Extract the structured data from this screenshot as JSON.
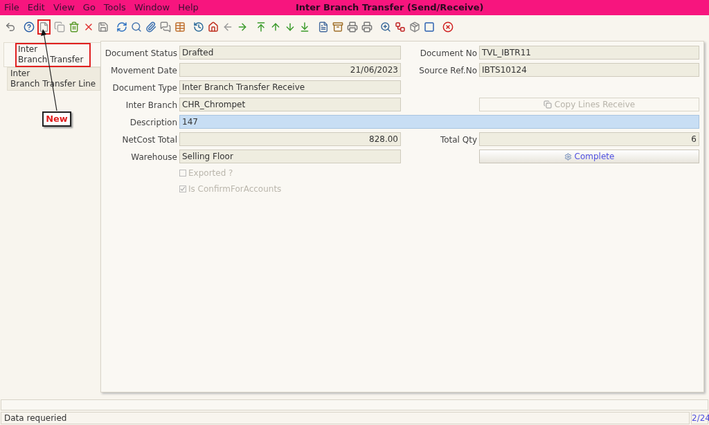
{
  "window": {
    "title": "Inter Branch Transfer (Send/Receive)"
  },
  "menu": [
    "File",
    "Edit",
    "View",
    "Go",
    "Tools",
    "Window",
    "Help"
  ],
  "tabs": [
    {
      "label": "Inter\nBranch Transfer",
      "selected": true
    },
    {
      "label": "Inter\nBranch Transfer Line",
      "selected": false
    }
  ],
  "rows": [
    {
      "kind": "pair",
      "left": {
        "kind": "text",
        "label": "Document Status",
        "value": "Drafted"
      },
      "right": {
        "kind": "text",
        "label": "Document No",
        "value": "TVL_IBTR11"
      }
    },
    {
      "kind": "pair",
      "left": {
        "kind": "number",
        "label": "Movement Date",
        "value": "21/06/2023"
      },
      "right": {
        "kind": "text",
        "label": "Source Ref.No",
        "value": "IBTS10124"
      }
    },
    {
      "kind": "pair",
      "left": {
        "kind": "text",
        "label": "Document Type",
        "value": "Inter Branch Transfer Receive"
      }
    },
    {
      "kind": "pair",
      "left": {
        "kind": "text",
        "label": "Inter Branch",
        "value": "CHR_Chrompet"
      },
      "right": {
        "kind": "button",
        "label": "Copy Lines Receive",
        "disabled": true
      }
    },
    {
      "kind": "wide",
      "label": "Description",
      "value": "147",
      "focused": true
    },
    {
      "kind": "pair",
      "left": {
        "kind": "number",
        "label": "NetCost Total",
        "value": "828.00"
      },
      "right": {
        "kind": "number",
        "label": "Total Qty",
        "value": "6"
      }
    },
    {
      "kind": "pair",
      "left": {
        "kind": "text",
        "label": "Warehouse",
        "value": "Selling Floor"
      },
      "right": {
        "kind": "button",
        "label": "Complete",
        "disabled": false
      }
    },
    {
      "kind": "pair",
      "left": {
        "kind": "checkbox",
        "label": "Exported ?",
        "checked": false,
        "disabled": true
      }
    },
    {
      "kind": "pair",
      "left": {
        "kind": "checkbox",
        "label": "Is ConfirmForAccounts",
        "checked": true,
        "disabled": true
      }
    }
  ],
  "annotation": {
    "label": "New"
  },
  "status_bar": {
    "message": "Data requeried",
    "page": "2/24"
  }
}
